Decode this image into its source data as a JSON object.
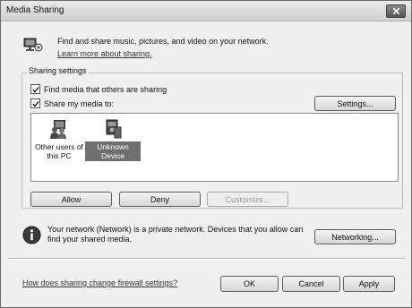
{
  "window": {
    "title": "Media Sharing"
  },
  "intro": {
    "text": "Find and share music, pictures, and video on your network.",
    "link": "Learn more about sharing."
  },
  "sharing_settings": {
    "label": "Sharing settings",
    "find_media": {
      "label": "Find media that others are sharing",
      "checked": true
    },
    "share_media": {
      "label": "Share my media to:",
      "checked": true
    },
    "settings_button": "Settings...",
    "devices": [
      {
        "label_line1": "Other users of",
        "label_line2": "this PC",
        "icon": "users-pc-icon",
        "selected": false
      },
      {
        "label_line1": "Unknown",
        "label_line2": "Device",
        "icon": "unknown-device-icon",
        "selected": true
      }
    ],
    "allow_button": "Allow",
    "deny_button": "Deny",
    "customize_button": "Customize..."
  },
  "network_info": {
    "line1": "Your network (Network) is a private network. Devices that you allow can",
    "line2": "find your shared media.",
    "networking_button": "Networking..."
  },
  "footer": {
    "firewall_link": "How does sharing change firewall settings?",
    "ok_button": "OK",
    "cancel_button": "Cancel",
    "apply_button": "Apply"
  }
}
